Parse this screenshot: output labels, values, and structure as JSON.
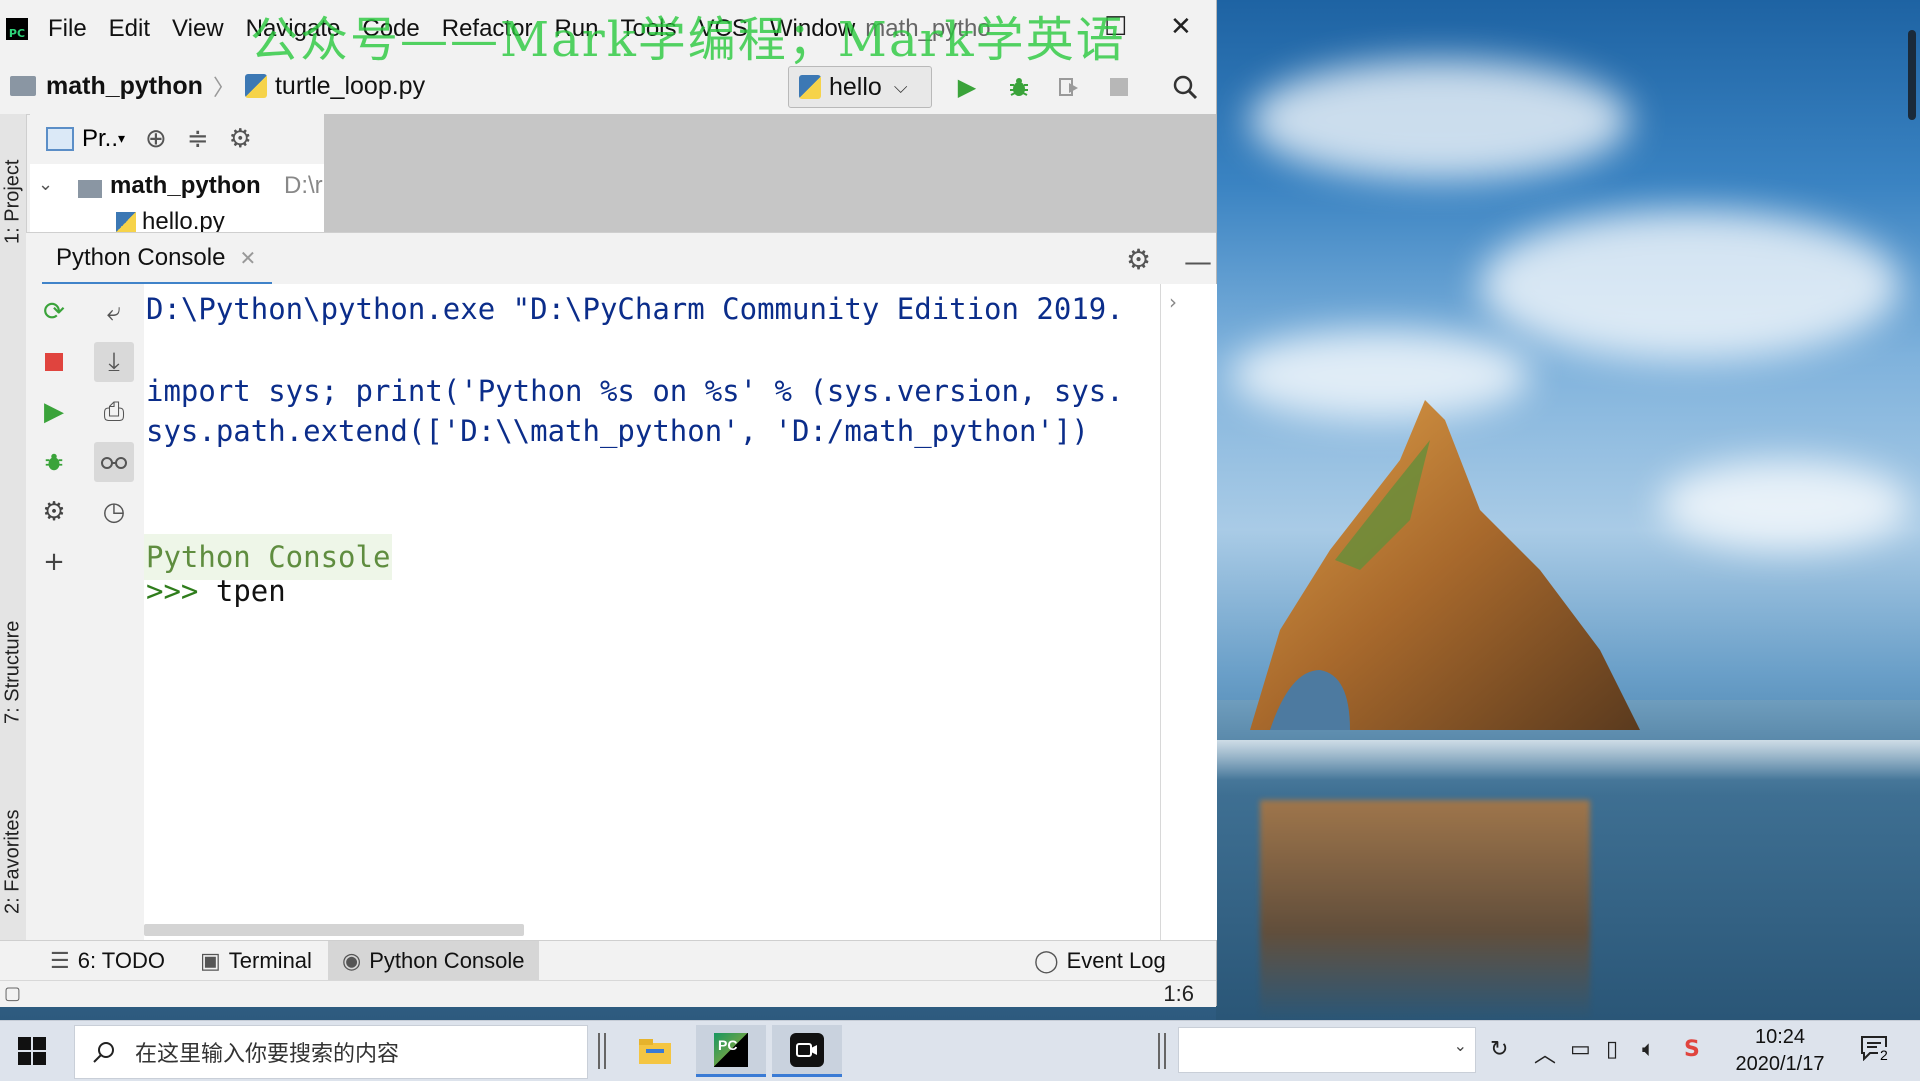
{
  "watermark": "公众号——Mark学编程；Mark学英语",
  "menu": {
    "items": [
      "File",
      "Edit",
      "View",
      "Navigate",
      "Code",
      "Refactor",
      "Run",
      "Tools",
      "VCS",
      "Window"
    ],
    "title": "math_pytho"
  },
  "navbar": {
    "project": "math_python",
    "file": "turtle_loop.py",
    "run_config": "hello"
  },
  "project_pane": {
    "toolbar_label": "Pr..",
    "root_name": "math_python",
    "root_path": "D:\\r",
    "child_file": "hello.py"
  },
  "left_stripe": {
    "project": "1: Project",
    "structure": "7: Structure",
    "favorites": "2: Favorites"
  },
  "console": {
    "tab_label": "Python Console",
    "lines": [
      "D:\\Python\\python.exe \"D:\\PyCharm Community Edition 2019.",
      "import sys; print('Python %s on %s' % (sys.version, sys.",
      "sys.path.extend(['D:\\\\math_python', 'D:/math_python'])"
    ],
    "banner": "Python Console",
    "prompt": ">>>",
    "input": "tpen"
  },
  "bottom_tabs": {
    "todo": "6: TODO",
    "terminal": "Terminal",
    "python_console": "Python Console",
    "event_log": "Event Log"
  },
  "status": {
    "position": "1:6"
  },
  "taskbar": {
    "search_placeholder": "在这里输入你要搜索的内容",
    "time": "10:24",
    "date": "2020/1/17",
    "notification_count": "2"
  },
  "colors": {
    "accent": "#4083c9",
    "console_text": "#0b2d8a",
    "prompt": "#2f7d1c",
    "run_green": "#3aa33a",
    "stop_red": "#e0443e"
  }
}
